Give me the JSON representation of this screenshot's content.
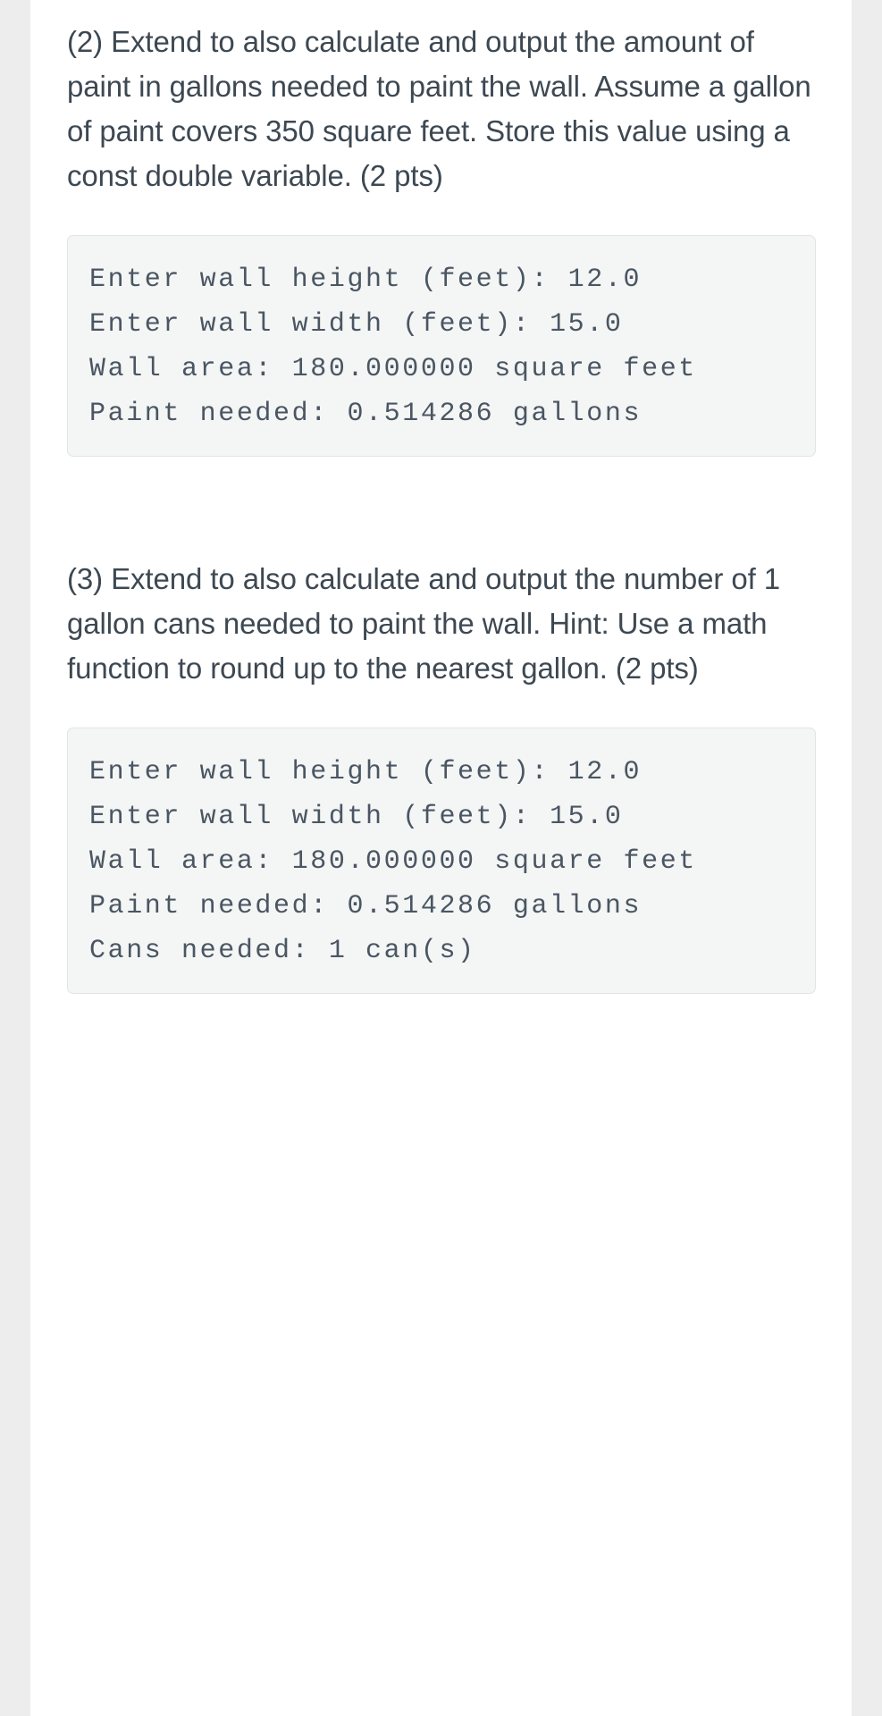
{
  "document": {
    "background_color": "#ededed",
    "page_color": "#ffffff",
    "text_color": "#3d4852",
    "code_background": "#f4f5f5",
    "code_border": "#e2e4e5",
    "code_text_color": "#4a5662"
  },
  "sections": [
    {
      "id": "question-2",
      "question": "(2) Extend to also calculate and output the amount of paint in gallons needed to paint the wall. Assume a gallon of paint covers 350 square feet. Store this value using a const double variable. (2 pts)",
      "output": "Enter wall height (feet): 12.0\nEnter wall width (feet): 15.0\nWall area: 180.000000 square feet\nPaint needed: 0.514286 gallons"
    },
    {
      "id": "question-3",
      "question": "(3) Extend to also calculate and output the number of 1 gallon cans needed to paint the wall. Hint: Use a math function to round up to the nearest gallon. (2 pts)",
      "output": "Enter wall height (feet): 12.0\nEnter wall width (feet): 15.0\nWall area: 180.000000 square feet\nPaint needed: 0.514286 gallons\nCans needed: 1 can(s)"
    }
  ]
}
